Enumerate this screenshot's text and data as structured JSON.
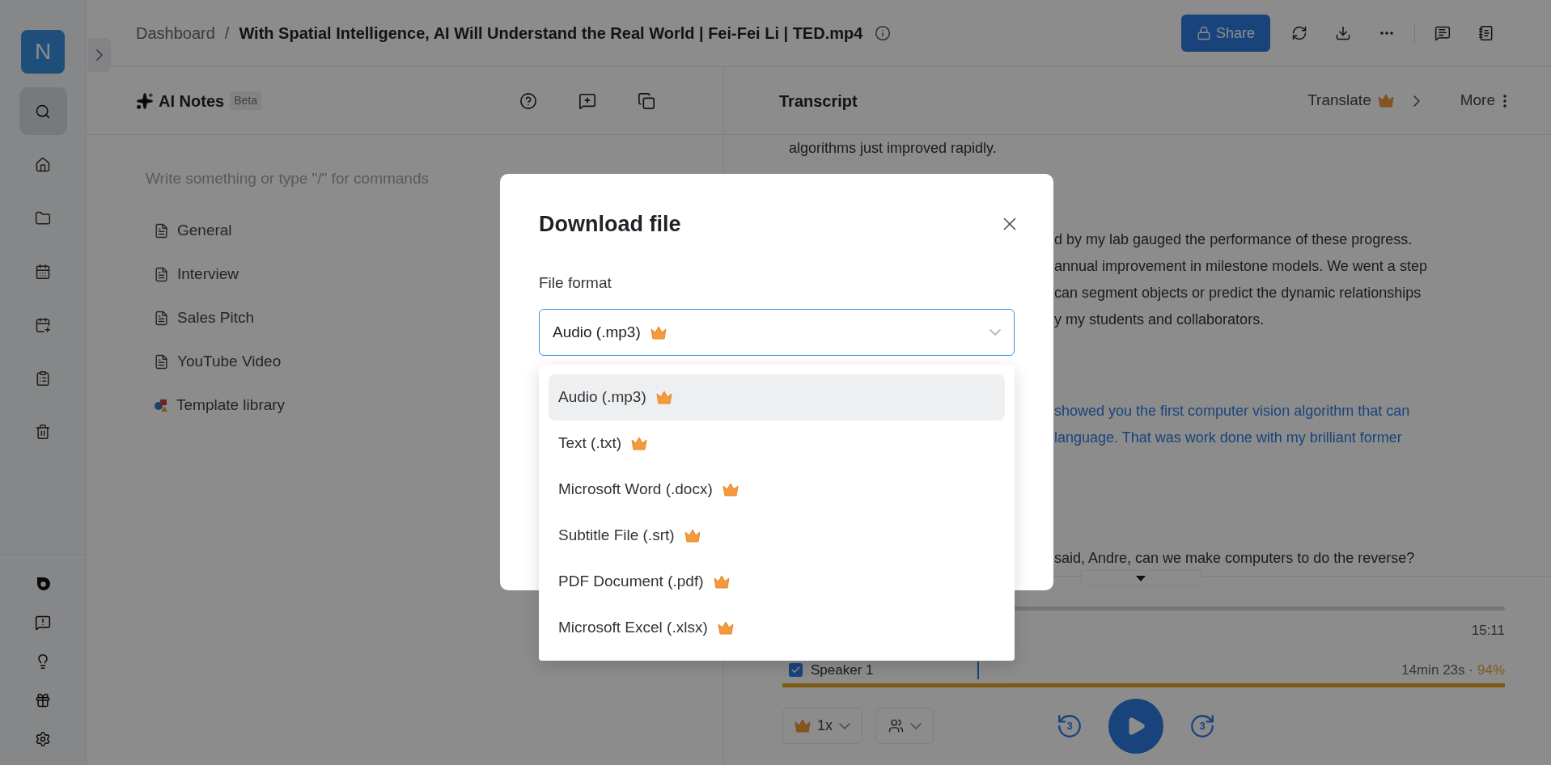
{
  "sidebar": {
    "avatar": "N",
    "nav_items": [
      {
        "kind": "search",
        "selected": true
      },
      {
        "kind": "home",
        "selected": false
      },
      {
        "kind": "folder",
        "selected": false
      },
      {
        "kind": "calendar",
        "selected": false
      },
      {
        "kind": "calendar-add",
        "selected": false
      },
      {
        "kind": "list",
        "selected": false
      },
      {
        "kind": "trash",
        "selected": false
      }
    ],
    "bottom_items": [
      {
        "kind": "logo"
      },
      {
        "kind": "feedback"
      },
      {
        "kind": "idea"
      },
      {
        "kind": "gift"
      },
      {
        "kind": "settings"
      }
    ]
  },
  "breadcrumb": {
    "parent": "Dashboard",
    "separator": "/",
    "current": "With Spatial Intelligence, AI Will Understand the Real World | Fei-Fei Li | TED.mp4"
  },
  "toolbar": {
    "share_label": "Share"
  },
  "notes": {
    "title": "AI Notes",
    "badge": "Beta",
    "placeholder": "Write something or type \"/\" for commands",
    "templates": [
      {
        "kind": "doc",
        "label": "General"
      },
      {
        "kind": "doc",
        "label": "Interview"
      },
      {
        "kind": "doc",
        "label": "Sales Pitch"
      },
      {
        "kind": "doc",
        "label": "YouTube Video"
      },
      {
        "kind": "library",
        "label": "Template library"
      }
    ]
  },
  "transcript": {
    "title": "Transcript",
    "translate": "Translate",
    "more": "More",
    "paragraphs": [
      {
        "hidden_start": false,
        "highlighted": false,
        "lines": [
          "algorithms just improved rapidly."
        ]
      },
      {
        "hidden_start": true,
        "highlighted": false,
        "lines": [
          "d by my lab gauged the performance of these progress.",
          "annual improvement in milestone models. We went a step",
          "can segment objects or predict the dynamic relationships",
          "y my students and collaborators."
        ]
      },
      {
        "hidden_start": true,
        "highlighted": true,
        "lines": [
          "showed you the first computer vision algorithm that can",
          "language. That was work done with my brilliant former"
        ]
      },
      {
        "hidden_start": true,
        "highlighted": false,
        "lines": [
          "said, Andre, can we make computers to do the reverse?"
        ]
      }
    ]
  },
  "player": {
    "duration": "15:11",
    "speaker": {
      "name": "Speaker 1",
      "checked": true,
      "time": "14min 23s",
      "separator": "·",
      "share": "94%",
      "level": 1
    },
    "speed": "1x",
    "skip_back": "3",
    "skip_forward": "3"
  },
  "dialog": {
    "title": "Download file",
    "field_label": "File format",
    "value": "Audio (.mp3)",
    "options": [
      {
        "label": "Audio (.mp3)",
        "selected": true
      },
      {
        "label": "Text (.txt)",
        "selected": false
      },
      {
        "label": "Microsoft Word (.docx)",
        "selected": false
      },
      {
        "label": "Subtitle File (.srt)",
        "selected": false
      },
      {
        "label": "PDF Document (.pdf)",
        "selected": false
      },
      {
        "label": "Microsoft Excel (.xlsx)",
        "selected": false
      }
    ]
  }
}
